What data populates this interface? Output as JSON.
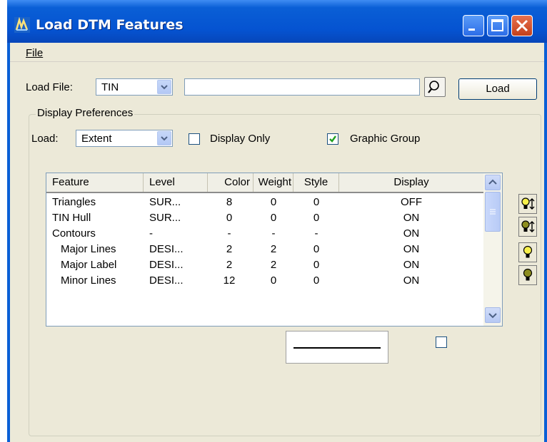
{
  "window": {
    "title": "Load DTM Features",
    "controls": [
      "minimize-icon",
      "maximize-icon",
      "close-icon"
    ]
  },
  "menu": {
    "file": "File"
  },
  "load_file": {
    "label": "Load File:",
    "type_value": "TIN",
    "path_value": "",
    "load_button": "Load"
  },
  "display_preferences": {
    "title": "Display Preferences",
    "load_label": "Load:",
    "load_value": "Extent",
    "display_only_label": "Display Only",
    "display_only_checked": false,
    "graphic_group_label": "Graphic Group",
    "graphic_group_checked": true
  },
  "table": {
    "columns": [
      "Feature",
      "Level",
      "Color",
      "Weight",
      "Style",
      "Display"
    ],
    "rows": [
      {
        "feature": "Triangles",
        "level": "SUR...",
        "color": "8",
        "weight": "0",
        "style": "0",
        "display": "OFF"
      },
      {
        "feature": "TIN Hull",
        "level": "SUR...",
        "color": "0",
        "weight": "0",
        "style": "0",
        "display": "ON"
      },
      {
        "feature": "Contours",
        "level": "-",
        "color": "-",
        "weight": "-",
        "style": "-",
        "display": "ON"
      },
      {
        "feature": "Major Lines",
        "level": "DESI...",
        "color": "2",
        "weight": "2",
        "style": "0",
        "display": "ON"
      },
      {
        "feature": "Major Label",
        "level": "DESI...",
        "color": "2",
        "weight": "2",
        "style": "0",
        "display": "ON"
      },
      {
        "feature": "Minor Lines",
        "level": "DESI...",
        "color": "12",
        "weight": "0",
        "style": "0",
        "display": "ON"
      }
    ]
  },
  "side_buttons": [
    "bulb-on-toggle-icon",
    "bulb-dark-toggle-icon",
    "bulb-on-icon",
    "bulb-off-icon"
  ],
  "colors": {
    "titlebar": "#0a5fd6",
    "dialog": "#ece9d8",
    "selection_check": "#21a121"
  }
}
